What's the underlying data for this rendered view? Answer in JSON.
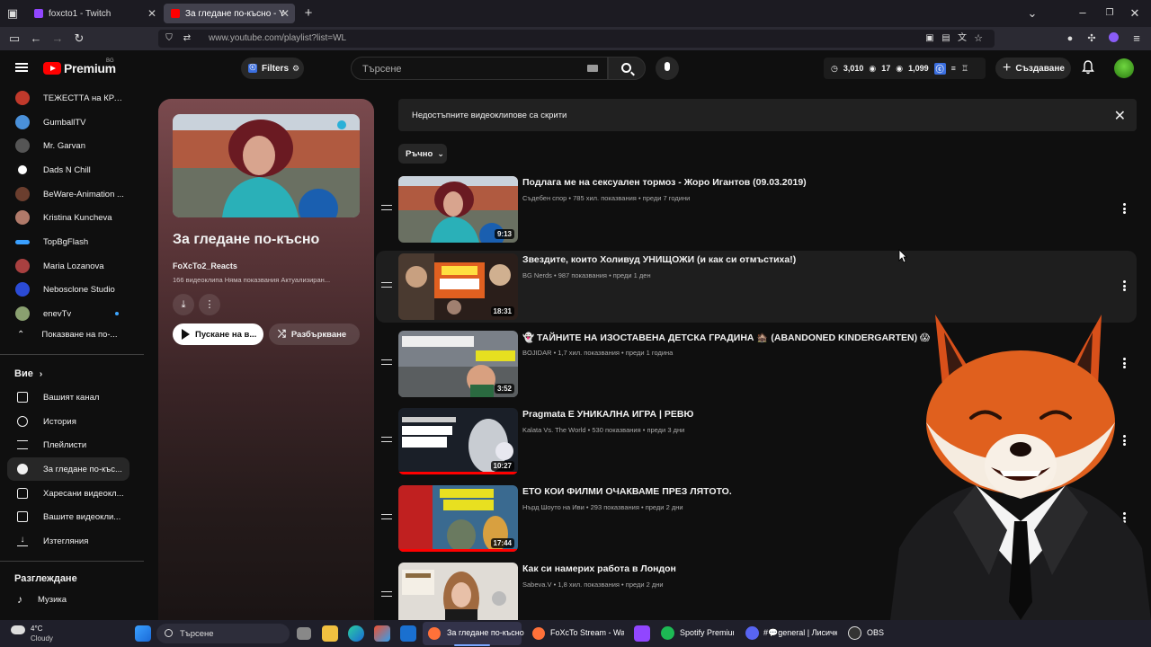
{
  "browser": {
    "tabs": [
      {
        "title": "foxcto1 - Twitch",
        "color": "#9146ff"
      },
      {
        "title": "За гледане по-късно - YouTub",
        "color": "#ff0000"
      }
    ],
    "url": "www.youtube.com/playlist?list=WL"
  },
  "header": {
    "logo_text": "Premium",
    "country": "BG",
    "filters_label": "Filters",
    "search_placeholder": "Търсене",
    "stats": [
      "3,010",
      "17",
      "1,099"
    ],
    "create_label": "Създаване"
  },
  "sidebar": {
    "subscriptions": [
      {
        "label": "ТЕЖЕСТТА на КРА...",
        "color": "#c0392b"
      },
      {
        "label": "GumballTV",
        "color": "#4a90d9"
      },
      {
        "label": "Mr. Garvan",
        "color": "#555555"
      },
      {
        "label": "Dads N Chill",
        "color": "#ffffff"
      },
      {
        "label": "BeWare-Animation ...",
        "color": "#6b3e2e"
      },
      {
        "label": "Kristina Kuncheva",
        "color": "#b07a6a"
      },
      {
        "label": "TopBgFlash",
        "color": "#3aa0ff"
      },
      {
        "label": "Maria Lozanova",
        "color": "#a84040"
      },
      {
        "label": "Nebosclone Studio",
        "color": "#2b4bd6"
      },
      {
        "label": "enevTv",
        "color": "#8aa070"
      }
    ],
    "show_less": "Показване на по-...",
    "you_heading": "Вие",
    "you_items": [
      {
        "label": "Вашият канал",
        "icon": "channel-icon"
      },
      {
        "label": "История",
        "icon": "history-icon"
      },
      {
        "label": "Плейлисти",
        "icon": "playlists-icon"
      },
      {
        "label": "За гледане по-къс...",
        "icon": "watch-later-icon"
      },
      {
        "label": "Харесани видеокл...",
        "icon": "like-icon"
      },
      {
        "label": "Вашите видеокли...",
        "icon": "your-videos-icon"
      },
      {
        "label": "Изтегляния",
        "icon": "download-icon"
      }
    ],
    "explore_heading": "Разглеждане",
    "explore_items": [
      {
        "label": "Музика",
        "icon": "music-icon"
      }
    ]
  },
  "playlist": {
    "title": "За гледане по-късно",
    "owner": "FoXcTo2_Reacts",
    "meta": "166 видеоклипа  Няма показвания  Актуализиран...",
    "play_label": "Пускане на в...",
    "shuffle_label": "Разбъркване"
  },
  "main": {
    "banner_text": "Недостъпните видеоклипове са скрити",
    "sort_label": "Ръчно",
    "videos": [
      {
        "title": "Подлага ме на сексуален тормоз - Жоро Игантов (09.03.2019)",
        "meta": "Съдебен спор • 785 хил. показвания • преди 7 години",
        "duration": "9:13",
        "progress": 0.0
      },
      {
        "title": "Звездите, които Холивуд УНИЩОЖИ (и как си отмъстиха!)",
        "meta": "BG Nerds • 987 показвания • преди 1 ден",
        "duration": "18:31",
        "progress": 0.0
      },
      {
        "title": "👻 ТАЙНИТЕ НА ИЗОСТАВЕНА ДЕТСКА ГРАДИНА 🏚️ (ABANDONED KINDERGARTEN) 😱",
        "meta": "BOJIDAR • 1,7 хил. показвания • преди 1 година",
        "duration": "3:52",
        "progress": 0.0
      },
      {
        "title": "Pragmata Е УНИКАЛНА ИГРА | РЕВЮ",
        "meta": "Kalata Vs. The World • 530 показвания • преди 3 дни",
        "duration": "10:27",
        "progress": 1.0
      },
      {
        "title": "ЕТО КОИ ФИЛМИ ОЧАКВАМЕ ПРЕЗ ЛЯТОТО.",
        "meta": "Нърд Шоуто на Иви • 293 показвания • преди 2 дни",
        "duration": "17:44",
        "progress": 1.0
      },
      {
        "title": "Как си намерих работа в Лондон",
        "meta": "Sabeva.V • 1,8 хил. показвания • преди 2 дни",
        "duration": "",
        "progress": 0.0
      }
    ]
  },
  "taskbar": {
    "weather_temp": "4°C",
    "weather_desc": "Cloudy",
    "search_placeholder": "Търсене",
    "apps": [
      {
        "label": "За гледане по-късно",
        "color": "#ff7139"
      },
      {
        "label": "FoXcTo Stream - Watcl",
        "color": "#ff7139"
      },
      {
        "label": "Spotify Premium",
        "color": "#1db954"
      },
      {
        "label": "#💬general | Лисичка",
        "color": "#5865f2"
      },
      {
        "label": "OBS",
        "color": "#333333"
      }
    ]
  }
}
